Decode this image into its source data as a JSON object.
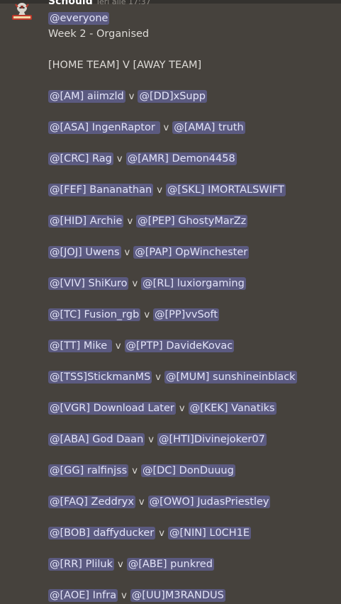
{
  "message": {
    "author": "Schould",
    "timestamp": "Ieri alle 17:37",
    "everyone": "@everyone",
    "week": "Week 2 - Organised",
    "format": "[HOME TEAM] V [AWAY TEAM]",
    "separator": "v",
    "fixtures": [
      {
        "home": "@[AM] aiimzld",
        "away": "@[DD]xSupp"
      },
      {
        "home": "@[ASA] IngenRaptor ",
        "away": "@[AMA] truth"
      },
      {
        "home": "@[CRC] Rag",
        "away": "@[AMR] Demon4458"
      },
      {
        "home": "@[FEF] Bananathan",
        "away": "@[SKL] IMORTALSWIFT"
      },
      {
        "home": "@[HID] Archie",
        "away": "@[PEP] GhostyMarZz"
      },
      {
        "home": "@[JOJ] Uwens",
        "away": "@[PAP] OpWinchester"
      },
      {
        "home": "@[VIV] ShiKuro",
        "away": "@[RL] luxiorgaming"
      },
      {
        "home": "@[TC] Fusion_rgb",
        "away": "@[PP]vvSoft"
      },
      {
        "home": "@[TT] Mike ",
        "away": "@[PTP] DavideKovac"
      },
      {
        "home": "@[TSS]StickmanMS",
        "away": "@[MUM] sunshineinblack"
      },
      {
        "home": "@[VGR] Download Later",
        "away": "@[KEK] Vanatiks"
      },
      {
        "home": "@[ABA] God Daan",
        "away": "@[HTI]Divinejoker07"
      },
      {
        "home": "@[GG] ralfinjss",
        "away": "@[DC] DonDuuug"
      },
      {
        "home": "@[FAQ] Zeddryx",
        "away": "@[OWO] JudasPriestley"
      },
      {
        "home": "@[BOB] daffyducker",
        "away": "@[NIN] L0CH1E"
      },
      {
        "home": "@[RR] Pliluk",
        "away": "@[ABE] punkred"
      },
      {
        "home": "@[AOE] Infra",
        "away": "@[UU]M3RANDUS"
      }
    ]
  },
  "icons": {
    "avatar": "team-logo-avatar-icon"
  },
  "colors": {
    "background": "#46423d",
    "mention_bg": "#5b5a80",
    "text": "#dedcd8",
    "author": "#ffffff",
    "timestamp": "#8e8a84"
  }
}
